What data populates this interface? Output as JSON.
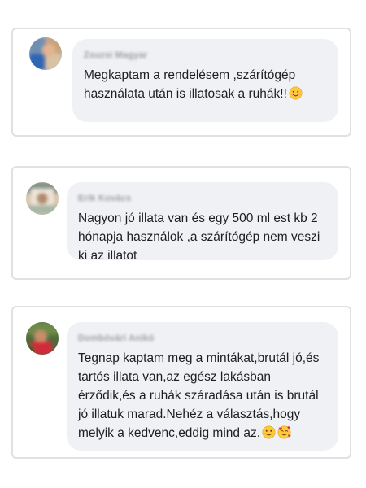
{
  "comments": [
    {
      "author": "Zsuzsi Magyar",
      "text": "Megkaptam a rendelésem ,szárítógép\nhasználata után is illatosak a ruhák!!",
      "emojis": [
        "smiling-face-icon"
      ]
    },
    {
      "author": "Erik Kovács",
      "text": "Nagyon jó illata van és egy 500 ml est kb 2\nhónapja használok ,a szárítógép nem veszi\nki az illatot",
      "emojis": []
    },
    {
      "author": "Dombóvári Anikó",
      "text": "Tegnap kaptam meg a mintákat,brutál jó,és\ntartós illata van,az egész lakásban\nérződik,és a ruhák száradása után is brutál\njó illatuk marad.Nehéz a választás,hogy\nmelyik a kedvenc,eddig mind az.",
      "emojis": [
        "smiling-face-icon",
        "smiling-face-with-hearts-icon"
      ]
    }
  ],
  "colors": {
    "bubble": "#eff1f4",
    "border": "#dfe1e5",
    "text": "#1c1e21"
  }
}
